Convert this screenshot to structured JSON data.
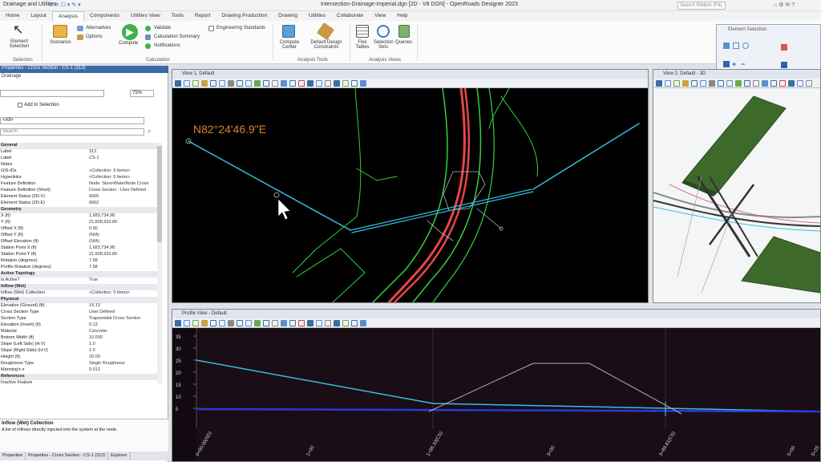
{
  "titlebar": {
    "left_title": "Drainage and Utilities",
    "doc_title": "Intersection-Drainage-Imperial.dgn [2D - V8 DGN] - OpenRoads Designer 2023",
    "search_placeholder": "Search Ribbon (F4)"
  },
  "tabs": [
    "Home",
    "Layout",
    "Analysis",
    "Components",
    "Utilities View",
    "Tools",
    "Report",
    "Drawing Production",
    "Drawing",
    "Utilities",
    "Collaborate",
    "View",
    "Help"
  ],
  "ribbon": {
    "element_selection": "Element Selection",
    "scenarios": "Scenarios",
    "alternatives": "Alternatives",
    "options": "Options",
    "compute": "Compute",
    "validate": "Validate",
    "calculation_summary": "Calculation Summary",
    "notifications": "Notifications",
    "engineering_standards": "Engineering Standards",
    "compute_center": "Compute Center",
    "default_design_constraints": "Default Design Constraints",
    "flex_tables": "Flex Tables",
    "selection_sets": "Selection Sets",
    "queries": "Queries",
    "group_selection": "Selection",
    "group_calculation": "Calculation",
    "group_analysis_tools": "Analysis Tools",
    "group_analysis_views": "Analysis Views",
    "element_selection_panel": "Element Selection"
  },
  "left_panel": {
    "title": "Properties - Cross Section - CS-1 (313)",
    "subtitle": "Drainage",
    "add_to_selection": "Add to Selection",
    "filter_all": "<All>",
    "search_placeholder": "Search",
    "zoom_value": "75%",
    "rows": [
      {
        "k": "General",
        "v": "",
        "sec": true
      },
      {
        "k": "Label",
        "v": "313"
      },
      {
        "k": "Label",
        "v": "CS-1"
      },
      {
        "k": "Notes",
        "v": ""
      },
      {
        "k": "GIS-IDs",
        "v": "<Collection: 0 items>"
      },
      {
        "k": "Hyperlinks",
        "v": "<Collection: 0 items>"
      },
      {
        "k": "Feature Definition",
        "v": "Node: StormWaterNode Cross"
      },
      {
        "k": "Feature Definition (Short)",
        "v": "Cross Section : User Defined"
      },
      {
        "k": "Element Status (2D-V)",
        "v": "6665"
      },
      {
        "k": "Element Status (2D-E)",
        "v": "6662"
      },
      {
        "k": "Geometry",
        "v": "",
        "sec": true
      },
      {
        "k": "X (ft)",
        "v": "1,683,734.98"
      },
      {
        "k": "Y (ft)",
        "v": "21,828,933.80"
      },
      {
        "k": "Offset X (ft)",
        "v": "0.00"
      },
      {
        "k": "Offset Y (ft)",
        "v": "(N/A)"
      },
      {
        "k": "Offset Elevation (ft)",
        "v": "(N/A)"
      },
      {
        "k": "Station Point X (ft)",
        "v": "1,683,734.98"
      },
      {
        "k": "Station Point Y (ft)",
        "v": "21,828,933.80"
      },
      {
        "k": "Rotation (degrees)",
        "v": "7.58"
      },
      {
        "k": "Profile Rotation (degrees)",
        "v": "7.58"
      },
      {
        "k": "Active Topology",
        "v": "",
        "sec": true
      },
      {
        "k": "Is Active?",
        "v": "True"
      },
      {
        "k": "Inflow (Wet)",
        "v": "",
        "sec": true
      },
      {
        "k": "Inflow (Wet) Collection",
        "v": "<Collection: 0 items>"
      },
      {
        "k": "Physical",
        "v": "",
        "sec": true
      },
      {
        "k": "Elevation (Ground) (ft)",
        "v": "19.13"
      },
      {
        "k": "Cross Section Type",
        "v": "User Defined"
      },
      {
        "k": "Section Type",
        "v": "Trapezoidal Cross Section"
      },
      {
        "k": "Elevation (Invert) (ft)",
        "v": "0.13"
      },
      {
        "k": "Material",
        "v": "Concrete"
      },
      {
        "k": "Bottom Width (ft)",
        "v": "10.000"
      },
      {
        "k": "Slope (Left Side) (H:V)",
        "v": "1.0"
      },
      {
        "k": "Slope (Right Side) (H:V)",
        "v": "1.0"
      },
      {
        "k": "Height (ft)",
        "v": "20.00"
      },
      {
        "k": "Roughness Type",
        "v": "Single Roughness"
      },
      {
        "k": "Manning's n",
        "v": "0.013"
      },
      {
        "k": "References",
        "v": "",
        "sec": true
      },
      {
        "k": "Inactive Feature",
        "v": ""
      }
    ],
    "footer_title": "Inflow (Wet) Collection",
    "footer_desc": "A list of inflows directly injected into the system at the node.",
    "bottom_tabs": [
      "Properties",
      "Properties - Cross Section - CS-1 (313)",
      "Explorer"
    ]
  },
  "views": {
    "view1_title": "View 1, Default",
    "view2_title": "View 2, Default - 3D",
    "profile_title": "Profile View - Default",
    "bearing_label": "N82°24'46.9\"E",
    "y_ticks": [
      "35",
      "30",
      "25",
      "20",
      "15",
      "10",
      "5"
    ],
    "x_ticks": [
      "0+00.00(SD)",
      "1+00",
      "1+86.33(CS)",
      "3+00",
      "3+89.81(CS)",
      "5+00",
      "5+25"
    ]
  },
  "colors": {
    "cyan": "#35c0df",
    "green": "#2fd23f",
    "red": "#e8454a",
    "orange": "#d8832a",
    "panel_blue": "#dde6f2"
  }
}
